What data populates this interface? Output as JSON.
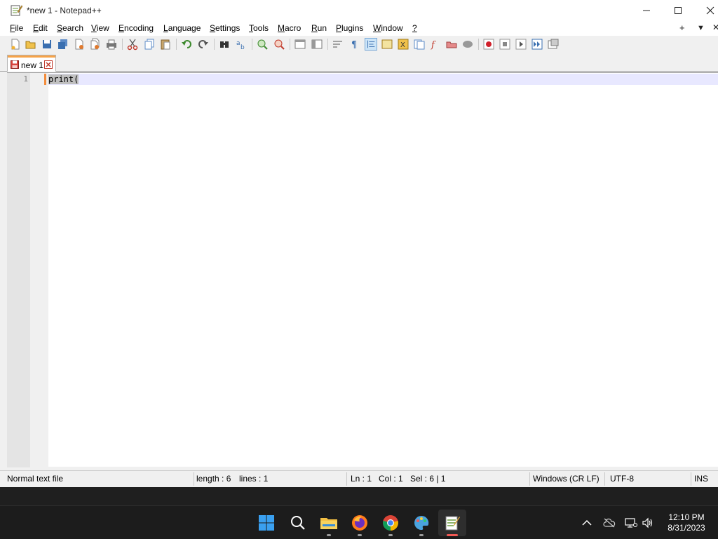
{
  "window": {
    "title": "*new 1 - Notepad++"
  },
  "menu": {
    "items": [
      {
        "label": "File",
        "u": "F",
        "rest": "ile"
      },
      {
        "label": "Edit",
        "u": "E",
        "rest": "dit"
      },
      {
        "label": "Search",
        "u": "S",
        "rest": "earch"
      },
      {
        "label": "View",
        "u": "V",
        "rest": "iew"
      },
      {
        "label": "Encoding",
        "u": "E",
        "rest": "ncoding"
      },
      {
        "label": "Language",
        "u": "L",
        "rest": "anguage"
      },
      {
        "label": "Settings",
        "u": "S",
        "rest": "ettings"
      },
      {
        "label": "Tools",
        "u": "T",
        "rest": "ools"
      },
      {
        "label": "Macro",
        "u": "M",
        "rest": "acro"
      },
      {
        "label": "Run",
        "u": "R",
        "rest": "un"
      },
      {
        "label": "Plugins",
        "u": "P",
        "rest": "lugins"
      },
      {
        "label": "Window",
        "u": "W",
        "rest": "indow"
      },
      {
        "label": "?",
        "u": "?",
        "rest": ""
      }
    ],
    "right": [
      "+",
      "▼",
      "✕"
    ]
  },
  "tab": {
    "label": "new 1"
  },
  "editor": {
    "line_number": "1",
    "code": "print("
  },
  "status": {
    "file_type": "Normal text file",
    "length": "length : 6",
    "lines": "lines : 1",
    "ln": "Ln : 1",
    "col": "Col : 1",
    "sel": "Sel : 6 | 1",
    "eol": "Windows (CR LF)",
    "encoding": "UTF-8",
    "mode": "INS"
  },
  "taskbar": {
    "time": "12:10 PM",
    "date": "8/31/2023"
  },
  "colors": {
    "tab_accent": "#f7a348",
    "caret_line": "#e8e8ff",
    "selection": "#c0c0c0",
    "taskbar_bg": "#1c1c1c"
  }
}
